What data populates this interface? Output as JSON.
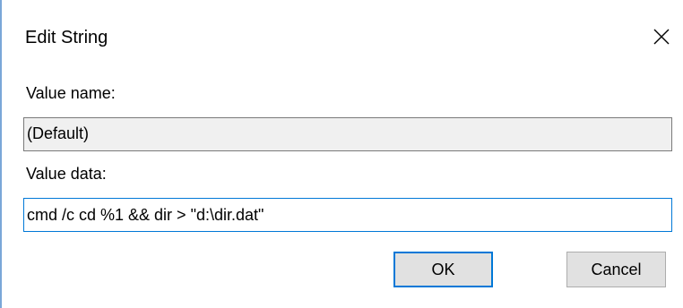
{
  "window": {
    "title": "Edit String",
    "close_icon": "close-icon"
  },
  "value_name": {
    "label": "Value name:",
    "value": "(Default)"
  },
  "value_data": {
    "label": "Value data:",
    "value": "cmd /c cd %1 && dir > \"d:\\dir.dat\""
  },
  "buttons": {
    "ok_label": "OK",
    "cancel_label": "Cancel"
  },
  "colors": {
    "focus_accent": "#0078d7",
    "readonly_field_bg": "#f0f0f0",
    "button_bg": "#e1e1e1"
  }
}
